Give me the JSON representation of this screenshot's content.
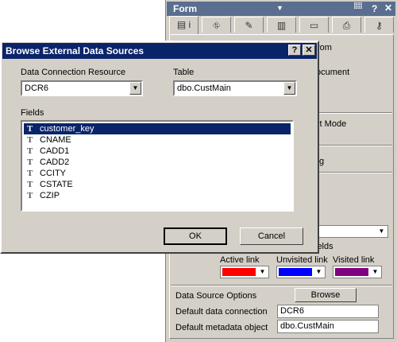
{
  "inspector": {
    "title": "Form",
    "partial_texts": [
      "rom",
      "ocument",
      "dit Mode",
      "g",
      "ields"
    ],
    "links": {
      "active_label": "Active link",
      "unvisited_label": "Unvisited link",
      "visited_label": "Visited link",
      "active_color": "#ff0000",
      "unvisited_color": "#0000ff",
      "visited_color": "#800080"
    },
    "data_source_options_label": "Data Source Options",
    "browse_label": "Browse",
    "default_connection_label": "Default data connection",
    "default_connection_value": "DCR6",
    "default_metadata_label": "Default metadata object",
    "default_metadata_value": "dbo.CustMain"
  },
  "dialog": {
    "title": "Browse External Data Sources",
    "help_glyph": "?",
    "close_glyph": "✕",
    "connection_label": "Data Connection Resource",
    "connection_value": "DCR6",
    "table_label": "Table",
    "table_value": "dbo.CustMain",
    "fields_label": "Fields",
    "fields": [
      "customer_key",
      "CNAME",
      "CADD1",
      "CADD2",
      "CCITY",
      "CSTATE",
      "CZIP"
    ],
    "selected_field": "customer_key",
    "field_icon": "T",
    "ok_label": "OK",
    "cancel_label": "Cancel"
  }
}
